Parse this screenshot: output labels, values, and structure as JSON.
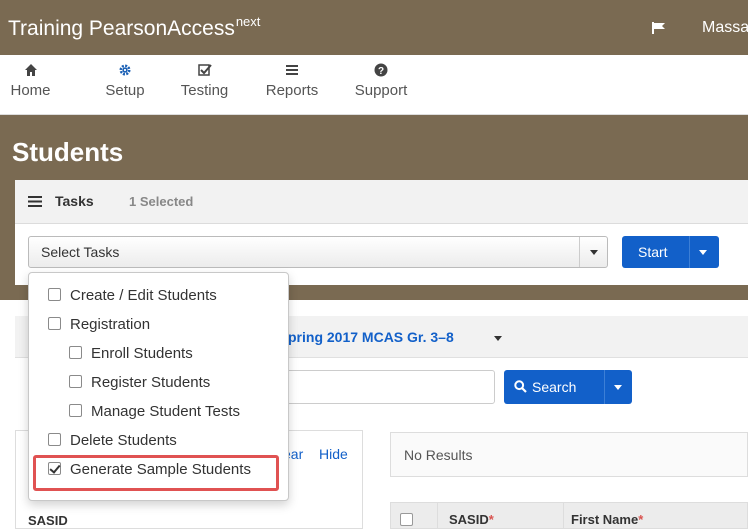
{
  "header": {
    "brand": "Training PearsonAccess",
    "brand_sup": "next",
    "org_label": "Massa"
  },
  "nav": [
    {
      "label": "Home",
      "icon": "home-icon"
    },
    {
      "label": "Setup",
      "icon": "gear-icon"
    },
    {
      "label": "Testing",
      "icon": "checkbox-icon"
    },
    {
      "label": "Reports",
      "icon": "list-icon"
    },
    {
      "label": "Support",
      "icon": "question-icon"
    }
  ],
  "page": {
    "title": "Students"
  },
  "tasks": {
    "title": "Tasks",
    "selected_count": "1 Selected",
    "select_placeholder": "Select Tasks",
    "start_label": "Start"
  },
  "dropdown": {
    "items": [
      {
        "label": "Create / Edit Students",
        "checked": false
      },
      {
        "label": "Registration",
        "checked": false
      },
      {
        "label": "Enroll Students",
        "checked": false
      },
      {
        "label": "Register Students",
        "checked": false
      },
      {
        "label": "Manage Student Tests",
        "checked": false
      },
      {
        "label": "Delete Students",
        "checked": false
      },
      {
        "label": "Generate Sample Students",
        "checked": true
      }
    ]
  },
  "filter": {
    "admin_label": "pring 2017 MCAS Gr. 3–8"
  },
  "search": {
    "button_label": "Search"
  },
  "left_card": {
    "clear_label": "ear",
    "hide_label": "Hide",
    "sasid_header": "SASID"
  },
  "results": {
    "text": "No Results",
    "columns": [
      "SASID",
      "First Name"
    ],
    "required_marker": "*"
  },
  "colors": {
    "header_bg": "#7a6a52",
    "primary": "#1260c9",
    "highlight": "#e05252"
  }
}
